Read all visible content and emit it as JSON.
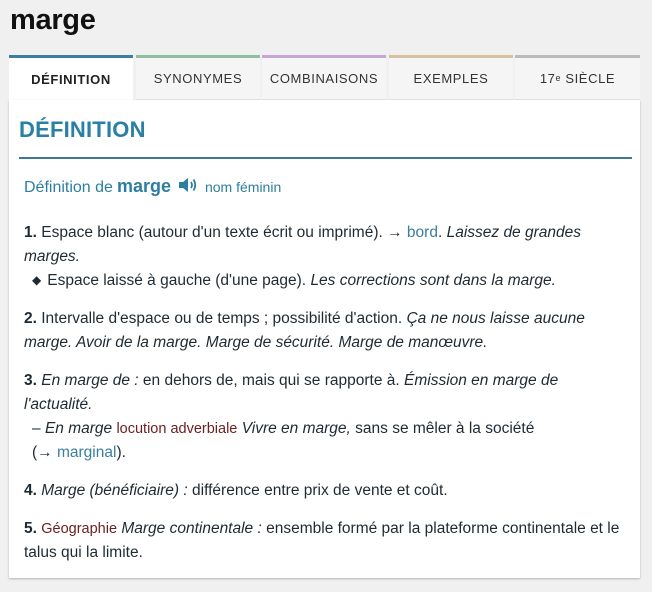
{
  "word": "marge",
  "tabs": [
    {
      "label": "DÉFINITION",
      "color": "#3b7fa0"
    },
    {
      "label": "SYNONYMES",
      "color": "#8fbfa3"
    },
    {
      "label": "COMBINAISONS",
      "color": "#c7a5d9"
    },
    {
      "label": "EXEMPLES",
      "color": "#d8c29e"
    },
    {
      "label_main": "17",
      "label_sup": "e",
      "label_rest": " SIÈCLE",
      "color": "#bbbbbb"
    }
  ],
  "section_title": "DÉFINITION",
  "def_head": {
    "prefix": "Définition de",
    "word": "marge",
    "speaker_icon": "speaker-icon",
    "gram": "nom féminin"
  },
  "definitions": {
    "d1": {
      "num": "1.",
      "text": "Espace blanc (autour d'un texte écrit ou imprimé).",
      "arrow": "→",
      "link": "bord",
      "dot": ".",
      "ex": "Laissez de grandes marges.",
      "sub": {
        "bullet": "◆",
        "text": "Espace laissé à gauche (d'une page).",
        "ex": "Les corrections sont dans la marge."
      }
    },
    "d2": {
      "num": "2.",
      "text": "Intervalle d'espace ou de temps ; possibilité d'action.",
      "ex": "Ça ne nous laisse aucune marge. Avoir de la marge. Marge de sécurité. Marge de manœuvre."
    },
    "d3": {
      "num": "3.",
      "ex_head": "En marge de :",
      "text": "en dehors de, mais qui se rapporte à.",
      "ex": "Émission en marge de l'actualité.",
      "sub": {
        "dash": "–",
        "ex_head": "En marge",
        "tag": "locution adverbiale",
        "ex": "Vivre en marge,",
        "text": "sans se mêler à la société",
        "open": "(→",
        "link": "marginal",
        "close": ")."
      }
    },
    "d4": {
      "num": "4.",
      "ex_head": "Marge (bénéficiaire) :",
      "text": "différence entre prix de vente et coût."
    },
    "d5": {
      "num": "5.",
      "tag": "Géographie",
      "ex_head": "Marge continentale :",
      "text": "ensemble formé par la plateforme continentale et le talus qui la limite."
    }
  }
}
